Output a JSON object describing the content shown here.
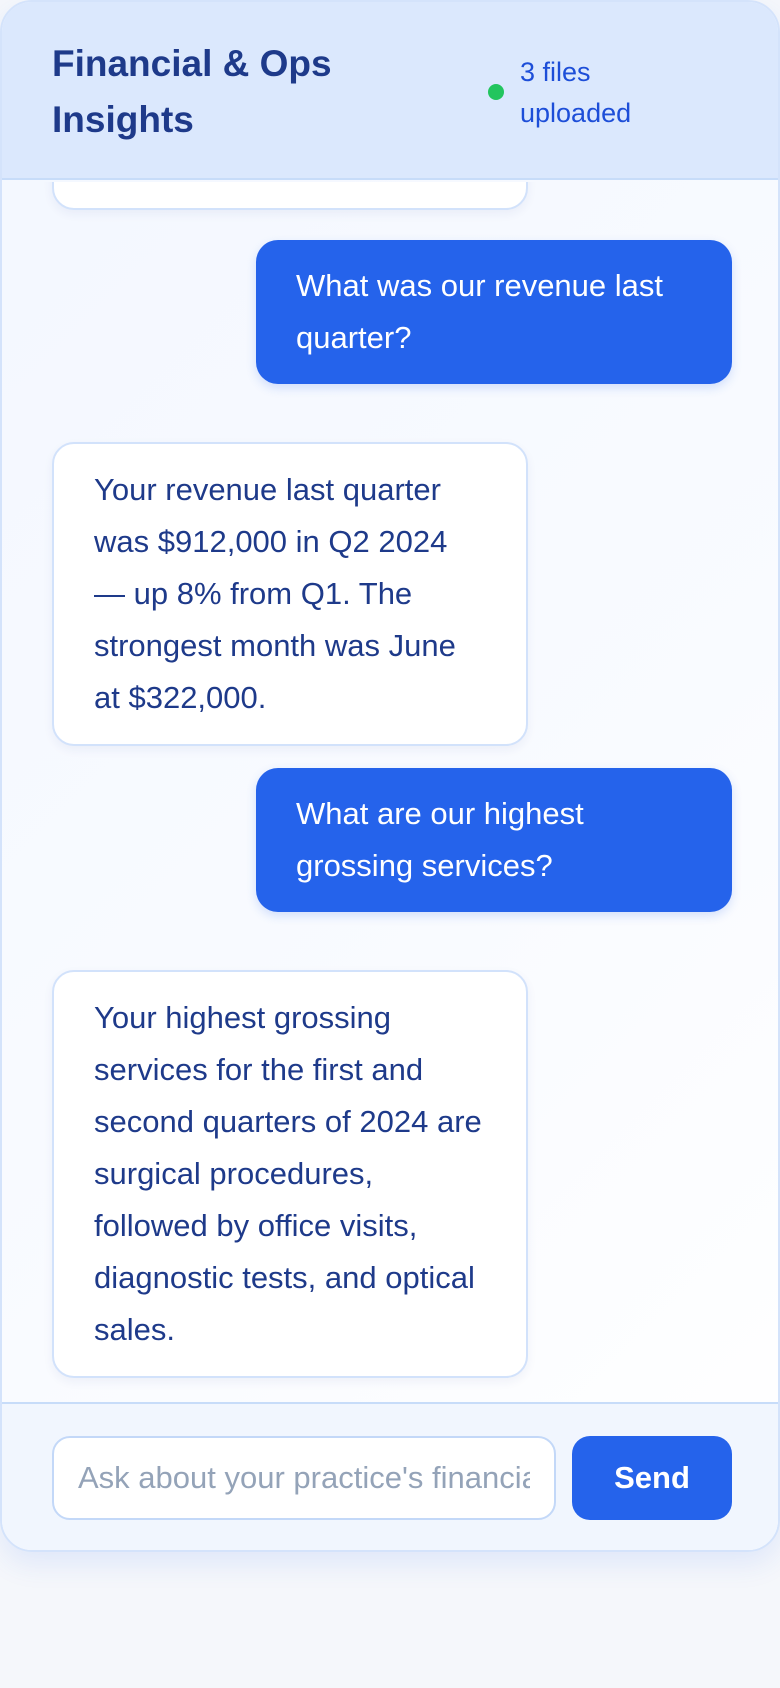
{
  "header": {
    "title": "Financial & Ops Insights",
    "status": "3 files uploaded",
    "status_color": "#22c55e"
  },
  "messages": [
    {
      "role": "assistant",
      "text": ""
    },
    {
      "role": "user",
      "text": "What was our revenue last quarter?"
    },
    {
      "role": "assistant",
      "text": "Your revenue last quarter was $912,000 in Q2 2024 — up 8% from Q1. The strongest month was June at $322,000."
    },
    {
      "role": "user",
      "text": "What are our highest grossing services?"
    },
    {
      "role": "assistant",
      "text": "Your highest grossing services for the first and second quarters of 2024 are surgical procedures, followed by office visits, diagnostic tests, and optical sales."
    }
  ],
  "composer": {
    "placeholder": "Ask about your practice's financials...",
    "value": "",
    "send_label": "Send"
  },
  "colors": {
    "accent": "#2563eb",
    "header_bg": "#dbe8fd",
    "text_primary": "#1e3a8a"
  }
}
